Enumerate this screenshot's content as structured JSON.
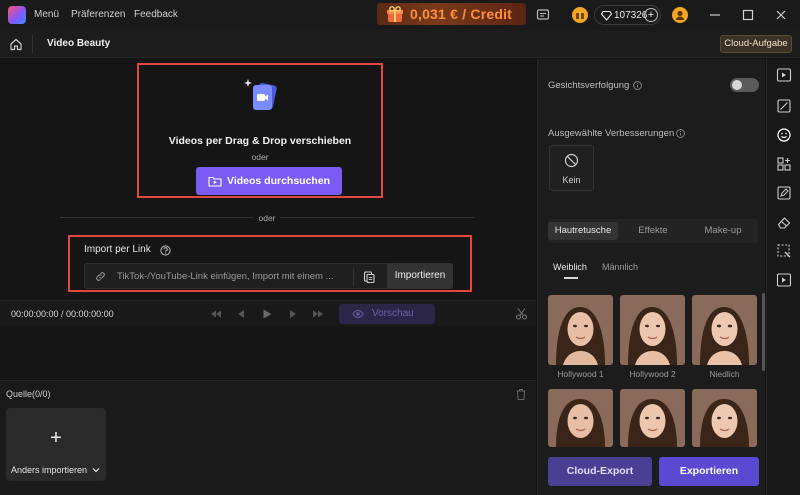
{
  "titlebar": {
    "menu": [
      "Menü",
      "Präferenzen",
      "Feedback"
    ],
    "credit_text": "0,031 € / Credit",
    "diamond_count": "107326",
    "diamond_plus": "+"
  },
  "subheader": {
    "page_title": "Video Beauty",
    "cloud_task": "Cloud-Aufgabe"
  },
  "dropzone": {
    "title": "Videos per Drag & Drop verschieben",
    "or": "oder",
    "browse_label": "Videos durchsuchen"
  },
  "separator_or": "oder",
  "link_import": {
    "title": "Import per Link",
    "placeholder": "TikTok-/YouTube-Link einfügen, Import mit einem ...",
    "import_label": "Importieren"
  },
  "player": {
    "timecode": "00:00:00:00 / 00:00:00:00",
    "preview_label": "Vorschau"
  },
  "source": {
    "title": "Quelle(0/0)",
    "import_plus": "+",
    "import_label": "Anders importieren"
  },
  "right_panel": {
    "face_tracking_label": "Gesichtsverfolgung",
    "face_tracking_on": false,
    "enhancements_label": "Ausgewählte Verbesserungen",
    "none_label": "Kein",
    "tabs": [
      "Hautretusche",
      "Effekte",
      "Make-up"
    ],
    "gender_tabs": [
      "Weiblich",
      "Männlich"
    ],
    "presets": [
      {
        "name": "Hollywood 1"
      },
      {
        "name": "Hollywood 2"
      },
      {
        "name": "Niedlich"
      },
      {
        "name": ""
      },
      {
        "name": ""
      },
      {
        "name": ""
      }
    ],
    "cloud_export": "Cloud-Export",
    "export": "Exportieren"
  },
  "colors": {
    "accent": "#7a5cf5",
    "highlight_border": "#e0473f",
    "credit_text": "#ff8f3a"
  },
  "icons": {
    "rail": [
      "video-enhance-icon",
      "crop-icon",
      "face-beauty-icon",
      "grid-add-icon",
      "edit-icon",
      "eraser-icon",
      "magic-select-icon",
      "video-export-icon"
    ]
  }
}
